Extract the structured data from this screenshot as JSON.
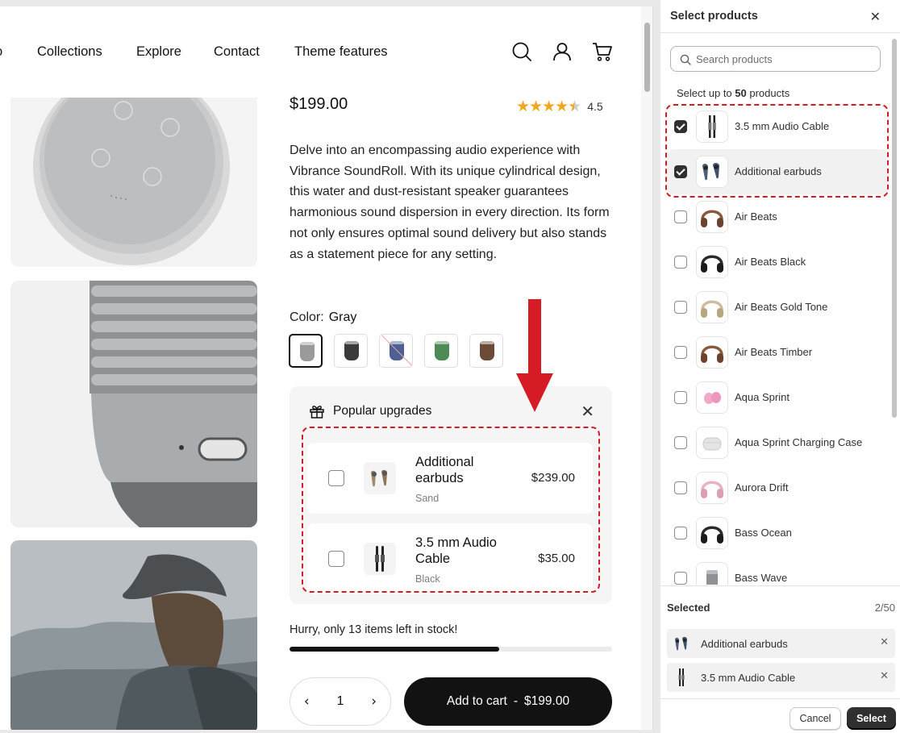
{
  "nav": {
    "links": [
      "o",
      "Collections",
      "Explore",
      "Contact",
      "Theme features"
    ],
    "icons": [
      "search-icon",
      "account-icon",
      "cart-icon"
    ]
  },
  "product": {
    "price": "$199.00",
    "rating": "4.5",
    "rating_fraction": 0.9,
    "description": "Delve into an encompassing audio experience with Vibrance SoundRoll. With its unique cylindrical design, this water and dust-resistant speaker guarantees harmonious sound dispersion in every direction. Its form not only ensures optimal sound delivery but also stands as a statement piece for any setting.",
    "color_label": "Color:",
    "color_value": "Gray",
    "swatches": [
      {
        "name": "Gray",
        "color": "#9a9a9a",
        "selected": true,
        "unavailable": false
      },
      {
        "name": "Black",
        "color": "#3a3a3a",
        "selected": false,
        "unavailable": false
      },
      {
        "name": "Blue",
        "color": "#4d5f93",
        "selected": false,
        "unavailable": true
      },
      {
        "name": "Green",
        "color": "#4e8a55",
        "selected": false,
        "unavailable": false
      },
      {
        "name": "Brown",
        "color": "#6b4a38",
        "selected": false,
        "unavailable": false
      }
    ]
  },
  "upgrades": {
    "title": "Popular upgrades",
    "items": [
      {
        "name": "Additional earbuds",
        "variant": "Sand",
        "price": "$239.00",
        "checked": false
      },
      {
        "name": "3.5 mm Audio Cable",
        "variant": "Black",
        "price": "$35.00",
        "checked": false
      }
    ]
  },
  "stock": {
    "text": "Hurry, only 13 items left in stock!",
    "level": 0.65
  },
  "cart": {
    "quantity": "1",
    "add_label": "Add to cart",
    "separator": "-",
    "add_price": "$199.00"
  },
  "picker": {
    "title": "Select products",
    "search_placeholder": "Search products",
    "limit_prefix": "Select up to",
    "limit_count": "50",
    "limit_suffix": "products",
    "products": [
      {
        "name": "3.5 mm Audio Cable",
        "checked": true,
        "thumb": "cable"
      },
      {
        "name": "Additional earbuds",
        "checked": true,
        "thumb": "earbuds-blue"
      },
      {
        "name": "Air Beats",
        "checked": false,
        "thumb": "headphones-brown"
      },
      {
        "name": "Air Beats Black",
        "checked": false,
        "thumb": "headphones-black"
      },
      {
        "name": "Air Beats Gold Tone",
        "checked": false,
        "thumb": "headphones-gold"
      },
      {
        "name": "Air Beats Timber",
        "checked": false,
        "thumb": "headphones-brown"
      },
      {
        "name": "Aqua Sprint",
        "checked": false,
        "thumb": "earbuds-pink"
      },
      {
        "name": "Aqua Sprint Charging Case",
        "checked": false,
        "thumb": "case-white"
      },
      {
        "name": "Aurora Drift",
        "checked": false,
        "thumb": "headphones-pink"
      },
      {
        "name": "Bass Ocean",
        "checked": false,
        "thumb": "headphones-black"
      },
      {
        "name": "Bass Wave",
        "checked": false,
        "thumb": "speaker-gray"
      }
    ],
    "selected_label": "Selected",
    "selected_count": "2/50",
    "selected": [
      {
        "name": "Additional earbuds",
        "thumb": "earbuds-blue"
      },
      {
        "name": "3.5 mm Audio Cable",
        "thumb": "cable"
      }
    ],
    "cancel_label": "Cancel",
    "select_label": "Select"
  },
  "colors": {
    "accent": "#121212",
    "annotation_red": "#d51b23",
    "star": "#f2a51d",
    "panel_primary": "#303030"
  }
}
